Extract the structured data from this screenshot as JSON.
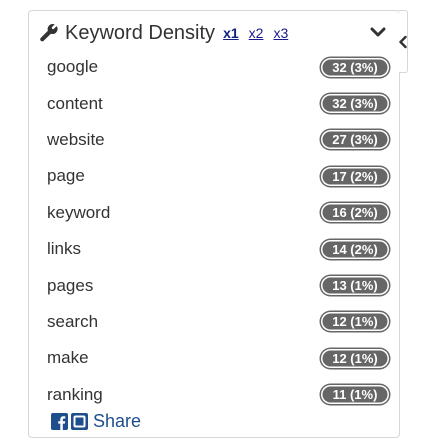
{
  "header": {
    "title": "Keyword Density",
    "multipliers": [
      "x1",
      "x2",
      "x3"
    ],
    "active_multiplier": "x1"
  },
  "keywords": [
    {
      "word": "google",
      "badge": "32 (3%)"
    },
    {
      "word": "content",
      "badge": "32 (3%)"
    },
    {
      "word": "website",
      "badge": "27 (3%)"
    },
    {
      "word": "page",
      "badge": "17 (2%)"
    },
    {
      "word": "keyword",
      "badge": "16 (2%)"
    },
    {
      "word": "links",
      "badge": "14 (2%)"
    },
    {
      "word": "pages",
      "badge": "13 (1%)"
    },
    {
      "word": "search",
      "badge": "12 (1%)"
    },
    {
      "word": "make",
      "badge": "12 (1%)"
    },
    {
      "word": "ranking",
      "badge": "11 (1%)"
    }
  ],
  "share": {
    "label": "Share"
  },
  "icons": {
    "wrench": "wrench-icon",
    "collapse": "chevron-down-icon",
    "side_tab": "chevron-left-icon",
    "facebook": "facebook-icon",
    "share_box": "share-box-icon"
  },
  "colors": {
    "badge_bg": "#666666",
    "link": "#1a1a8a",
    "share": "#1f4e8c",
    "text": "#333333"
  }
}
